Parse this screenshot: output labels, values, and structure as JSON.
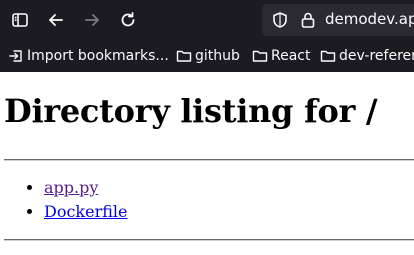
{
  "browser": {
    "url": "demodev.app",
    "icons": {
      "sidebar": "sidebar-icon",
      "back": "back-arrow-icon",
      "forward": "forward-arrow-icon",
      "reload": "reload-icon",
      "shield": "shield-icon",
      "lock": "lock-icon",
      "folder": "folder-icon",
      "import": "import-icon"
    },
    "colors": {
      "toolbar_bg": "#1c1b22",
      "urlbar_bg": "#2b2a33",
      "text": "#fbfbfe"
    }
  },
  "bookmarks": [
    {
      "label": "Import bookmarks...",
      "icon": "import-icon"
    },
    {
      "label": "github",
      "icon": "folder-icon"
    },
    {
      "label": "React",
      "icon": "folder-icon"
    },
    {
      "label": "dev-referen",
      "icon": "folder-icon"
    }
  ],
  "page": {
    "title": "Directory listing for /",
    "files": [
      {
        "name": "app.py",
        "visited": true
      },
      {
        "name": "Dockerfile",
        "visited": false
      }
    ],
    "colors": {
      "visited_link": "#551a8b",
      "link": "#0000ee"
    }
  }
}
